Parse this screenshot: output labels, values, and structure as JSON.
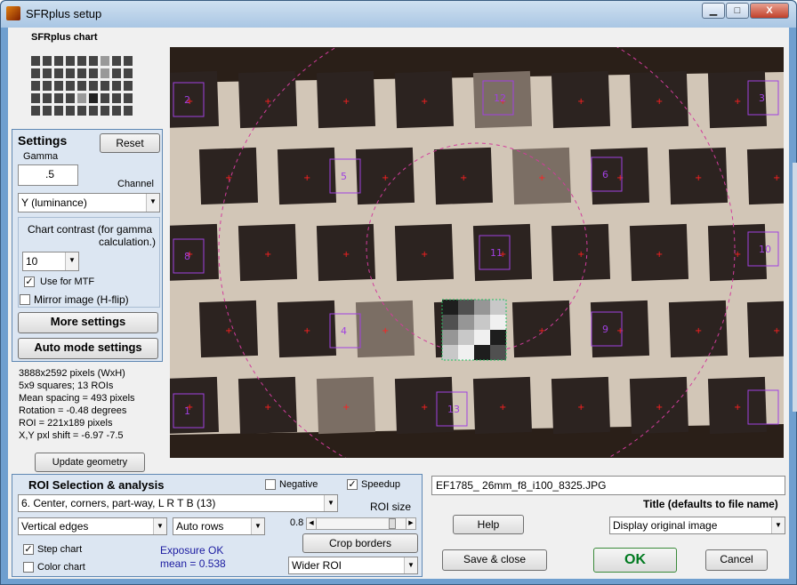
{
  "window": {
    "title": "SFRplus setup",
    "min": "▁",
    "max": "□",
    "close": "X"
  },
  "chart_title": "SFRplus chart",
  "settings": {
    "heading": "Settings",
    "reset": "Reset",
    "gamma_label": "Gamma",
    "gamma_value": ".5",
    "channel_label": "Channel",
    "channel_value": "Y (luminance)",
    "contrast_label_1": "Chart contrast (for gamma",
    "contrast_label_2": "calculation.)",
    "contrast_value": "10",
    "use_mtf": "Use for MTF",
    "mirror": "Mirror image (H-flip)",
    "more": "More settings",
    "auto": "Auto mode settings"
  },
  "info": [
    "3888x2592 pixels (WxH)",
    "5x9 squares;   13 ROIs",
    "Mean spacing = 493 pixels",
    "Rotation = -0.48 degrees",
    "ROI = 221x189 pixels",
    "X,Y pxl shift = -6.97  -7.5"
  ],
  "update_geometry": "Update geometry",
  "roi": {
    "heading": "ROI Selection & analysis",
    "negative": "Negative",
    "speedup": "Speedup",
    "selection": "6.  Center, corners, part-way, L R T B (13)",
    "edges": "Vertical edges",
    "rows": "Auto rows",
    "roi_size_label": "ROI size",
    "roi_size_value": "0.8",
    "crop": "Crop borders",
    "step_chart": "Step chart",
    "color_chart": "Color chart",
    "exposure_1": "Exposure OK",
    "exposure_2": "mean = 0.538",
    "wider": "Wider ROI"
  },
  "filename": "EF1785_ 26mm_f8_i100_8325.JPG",
  "title_hint": "Title (defaults to file name)",
  "help": "Help",
  "display": "Display original image",
  "save_close": "Save & close",
  "ok": "OK",
  "cancel": "Cancel",
  "roi_labels": [
    "2",
    "12",
    "3",
    "5",
    "6",
    "8",
    "10",
    "11",
    "4",
    "9",
    "13",
    "1"
  ],
  "colors": {
    "accent": "#7a9fcf",
    "ok_text": "#007a20",
    "exposure_text": "#1a1aa0"
  }
}
